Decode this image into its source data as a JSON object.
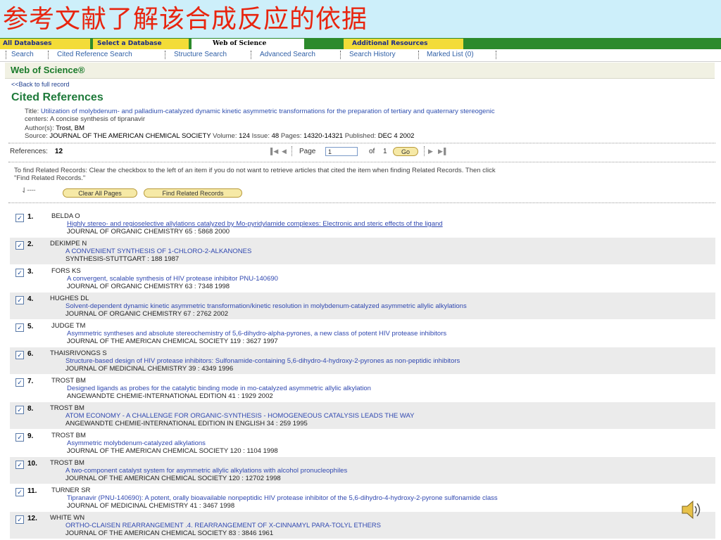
{
  "slide_title": "参考文献了解该合成反应的依据",
  "tabs": [
    {
      "label": "All Databases"
    },
    {
      "label": "Select a Database"
    },
    {
      "label": "Web of Science"
    },
    {
      "label": "Additional Resources"
    }
  ],
  "subnav": [
    {
      "label": "Search"
    },
    {
      "label": "Cited Reference Search"
    },
    {
      "label": "Structure Search"
    },
    {
      "label": "Advanced Search"
    },
    {
      "label": "Search History"
    },
    {
      "label": "Marked List (0)"
    }
  ],
  "brand": "Web of Science®",
  "back_link": "<<Back to full record",
  "heading": "Cited References",
  "record": {
    "title_label": "Title:",
    "title_line1": "Utilization of molybdenum- and palladium-catalyzed dynamic kinetic asymmetric transformations for the preparation of tertiary and quaternary stereogenic",
    "title_line2": "centers: A concise synthesis of tipranavir",
    "authors_label": "Author(s):",
    "authors": "Trost, BM",
    "source_label": "Source:",
    "journal": "JOURNAL OF THE AMERICAN CHEMICAL SOCIETY",
    "volume_label": "Volume:",
    "volume": "124",
    "issue_label": "Issue:",
    "issue": "48",
    "pages_label": "Pages:",
    "pages": "14320-14321",
    "published_label": "Published:",
    "published": "DEC 4 2002"
  },
  "references_label": "References:",
  "references_count": "12",
  "pager": {
    "page_label": "Page",
    "page_value": "1",
    "of_label": "of",
    "total": "1",
    "go_label": "Go"
  },
  "related_text_line1": "To find Related Records: Clear the checkbox to the left of an item if you do not want to retrieve articles that cited the item when finding Related Records. Then click",
  "related_text_line2": "\"Find Related Records.\"",
  "buttons": {
    "clear_all": "Clear All Pages",
    "find_related": "Find Related Records"
  },
  "references": [
    {
      "num": "1.",
      "author": "BELDA O",
      "title": "Highly stereo- and regioselective allylations catalyzed by Mo-pyridylamide complexes: Electronic and steric effects of the ligand",
      "source": "JOURNAL OF ORGANIC CHEMISTRY 65 : 5868 2000"
    },
    {
      "num": "2.",
      "author": "DEKIMPE N",
      "title": "A CONVENIENT SYNTHESIS OF 1-CHLORO-2-ALKANONES",
      "source": "SYNTHESIS-STUTTGART : 188 1987"
    },
    {
      "num": "3.",
      "author": "FORS KS",
      "title": "A convergent, scalable synthesis of HIV protease inhibitor PNU-140690",
      "source": "JOURNAL OF ORGANIC CHEMISTRY 63 : 7348 1998"
    },
    {
      "num": "4.",
      "author": "HUGHES DL",
      "title": "Solvent-dependent dynamic kinetic asymmetric transformation/kinetic resolution in molybdenum-catalyzed asymmetric allylic alkylations",
      "source": "JOURNAL OF ORGANIC CHEMISTRY 67 : 2762 2002"
    },
    {
      "num": "5.",
      "author": "JUDGE TM",
      "title": "Asymmetric syntheses and absolute stereochemistry of 5,6-dihydro-alpha-pyrones, a new class of potent HIV protease inhibitors",
      "source": "JOURNAL OF THE AMERICAN CHEMICAL SOCIETY 119 : 3627 1997"
    },
    {
      "num": "6.",
      "author": "THAISRIVONGS S",
      "title": "Structure-based design of HIV protease inhibitors: Sulfonamide-containing 5,6-dihydro-4-hydroxy-2-pyrones as non-peptidic inhibitors",
      "source": "JOURNAL OF MEDICINAL CHEMISTRY 39 : 4349 1996"
    },
    {
      "num": "7.",
      "author": "TROST BM",
      "title": "Designed ligands as probes for the catalytic binding mode in mo-catalyzed asymmetric allylic alkylation",
      "source": "ANGEWANDTE CHEMIE-INTERNATIONAL EDITION 41 : 1929 2002"
    },
    {
      "num": "8.",
      "author": "TROST BM",
      "title": "ATOM ECONOMY - A CHALLENGE FOR ORGANIC-SYNTHESIS - HOMOGENEOUS CATALYSIS LEADS THE WAY",
      "source": "ANGEWANDTE CHEMIE-INTERNATIONAL EDITION IN ENGLISH 34 : 259 1995"
    },
    {
      "num": "9.",
      "author": "TROST BM",
      "title": "Asymmetric molybdenum-catalyzed alkylations",
      "source": "JOURNAL OF THE AMERICAN CHEMICAL SOCIETY 120 : 1104 1998"
    },
    {
      "num": "10.",
      "author": "TROST BM",
      "title": "A two-component catalyst system for asymmetric allylic alkylations with alcohol pronucleophiles",
      "source": "JOURNAL OF THE AMERICAN CHEMICAL SOCIETY 120 : 12702 1998"
    },
    {
      "num": "11.",
      "author": "TURNER SR",
      "title": "Tipranavir (PNU-140690): A potent, orally bioavailable nonpeptidic HIV protease inhibitor of the 5,6-dihydro-4-hydroxy-2-pyrone sulfonamide class",
      "source": "JOURNAL OF MEDICINAL CHEMISTRY 41 : 3467 1998"
    },
    {
      "num": "12.",
      "author": "WHITE WN",
      "title": "ORTHO-CLAISEN REARRANGEMENT .4. REARRANGEMENT OF X-CINNAMYL PARA-TOLYL ETHERS",
      "source": "JOURNAL OF THE AMERICAN CHEMICAL SOCIETY 83 : 3846 1961"
    }
  ],
  "colors": {
    "slide_title_bg": "#cdeffa",
    "slide_title_text": "#e8250f",
    "tabbar_green": "#2c8a2c",
    "tab_yellow": "#f3dc38",
    "heading_green": "#1e7a3a",
    "link_blue": "#3048b0",
    "alt_row": "#ebebeb"
  },
  "icons": {
    "checkbox": "checked-checkbox-icon",
    "speaker": "speaker-icon",
    "pager_first": "first-page-icon",
    "pager_prev": "prev-page-icon",
    "pager_next": "next-page-icon",
    "pager_last": "last-page-icon"
  }
}
